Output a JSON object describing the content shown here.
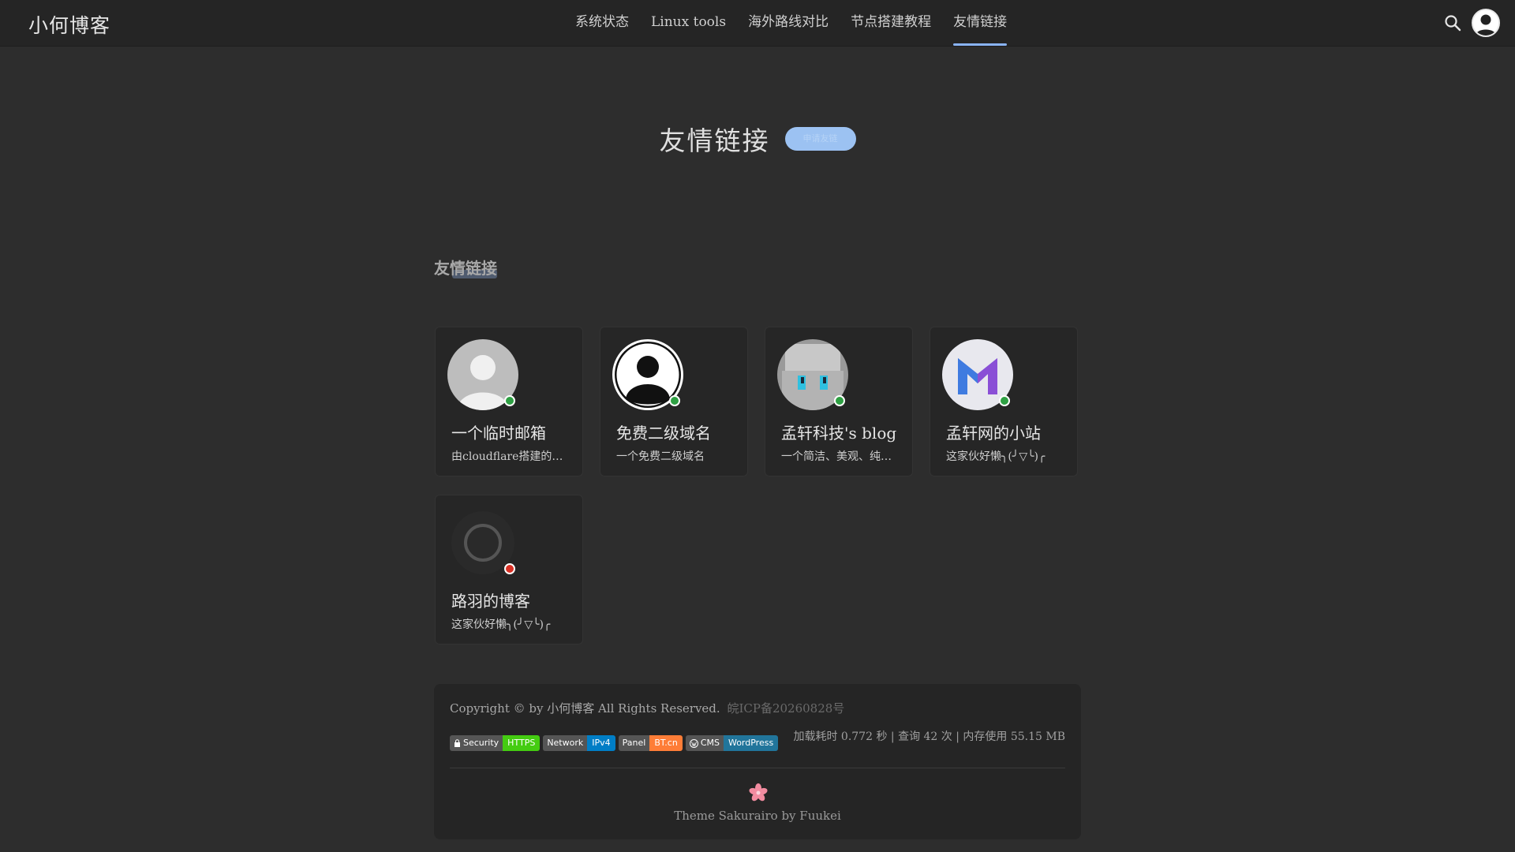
{
  "header": {
    "brand": "小何博客",
    "nav": [
      {
        "label": "系统状态"
      },
      {
        "label": "Linux tools"
      },
      {
        "label": "海外路线对比"
      },
      {
        "label": "节点搭建教程"
      },
      {
        "label": "友情链接",
        "active": true
      }
    ]
  },
  "page": {
    "title": "友情链接",
    "badge": "申请友链",
    "section_title": "友情链接"
  },
  "links": [
    {
      "name": "一个临时邮箱",
      "desc": "由cloudflare搭建的临时邮箱",
      "status": "online"
    },
    {
      "name": "免费二级域名",
      "desc": "一个免费二级域名",
      "status": "online"
    },
    {
      "name": "孟轩科技's blog",
      "desc": "一个简洁、美观、纯净的博客",
      "status": "online"
    },
    {
      "name": "孟轩网的小站",
      "desc": "这家伙好懒╮(╯▽╰)╭",
      "status": "online"
    },
    {
      "name": "路羽的博客",
      "desc": "这家伙好懒╮(╯▽╰)╭",
      "status": "offline"
    }
  ],
  "footer": {
    "copyright": "Copyright © by 小何博客 All Rights Reserved.",
    "icp": "皖ICP备20260828号",
    "stats": "加载耗时 0.772 秒 | 查询 42 次 | 内存使用 55.15 MB",
    "badges": [
      {
        "key": "Security",
        "value": "HTTPS",
        "color": "#4c1"
      },
      {
        "key": "Network",
        "value": "IPv4",
        "color": "#007ec6"
      },
      {
        "key": "Panel",
        "value": "BT.cn",
        "color": "#fe7d37"
      },
      {
        "key": "CMS",
        "value": "WordPress",
        "color": "#21759b"
      }
    ],
    "theme": "Theme Sakurairo by Fuukei"
  },
  "colors": {
    "accent": "#8ab4f8",
    "online": "#2ea043",
    "offline": "#d93025"
  }
}
